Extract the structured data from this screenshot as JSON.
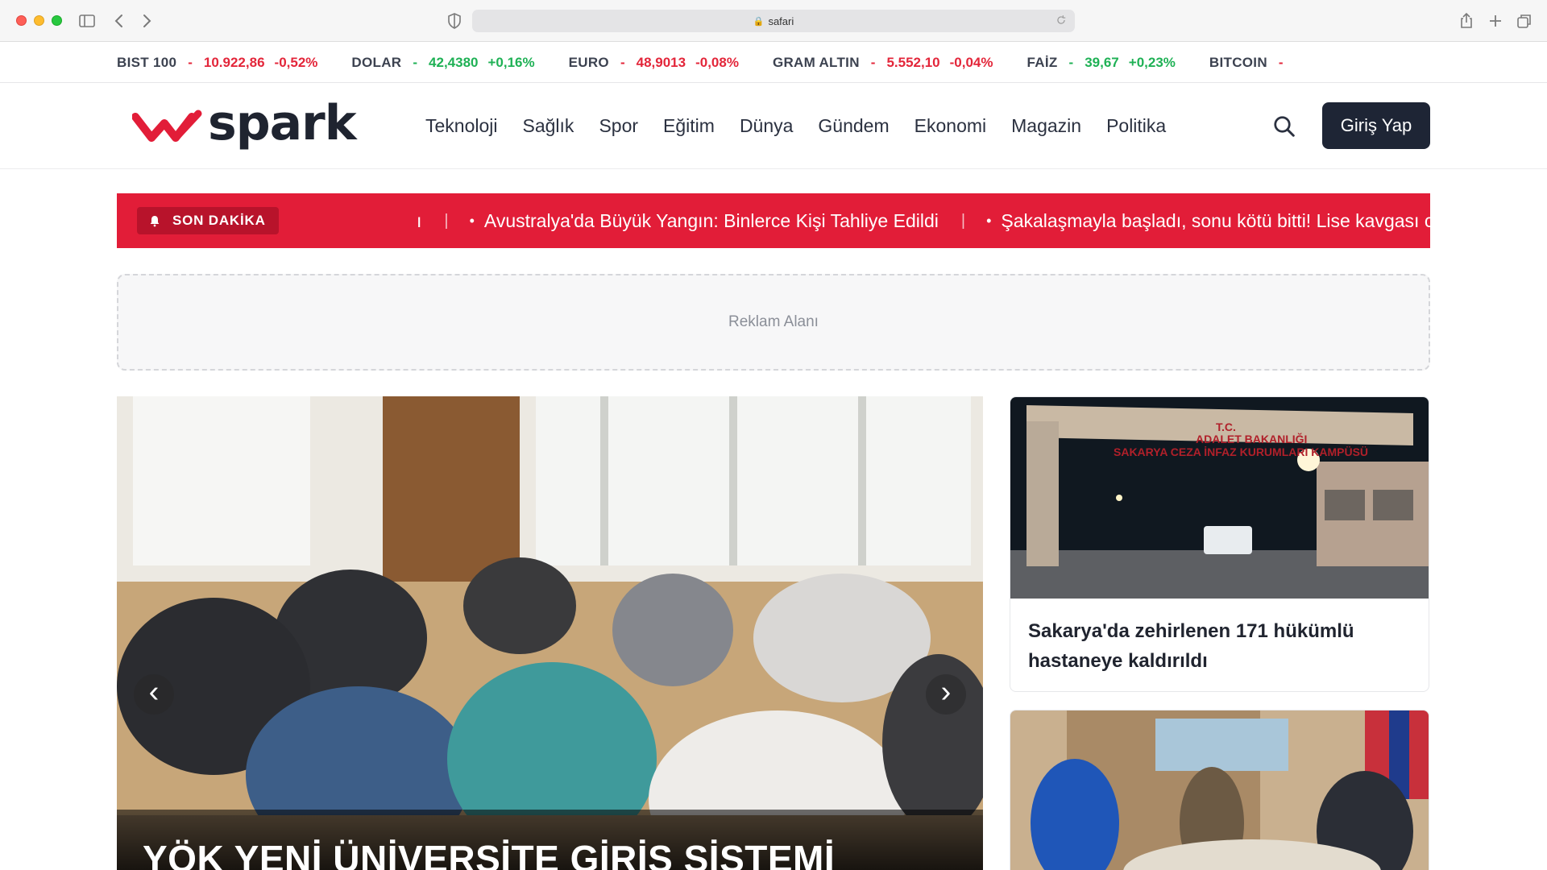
{
  "browser": {
    "address": "safari",
    "lock_glyph": "🔒"
  },
  "ticker": [
    {
      "name": "BIST 100",
      "value": "10.922,86",
      "change": "-0,52%",
      "direction": "down"
    },
    {
      "name": "DOLAR",
      "value": "42,4380",
      "change": "+0,16%",
      "direction": "up"
    },
    {
      "name": "EURO",
      "value": "48,9013",
      "change": "-0,08%",
      "direction": "down"
    },
    {
      "name": "GRAM ALTIN",
      "value": "5.552,10",
      "change": "-0,04%",
      "direction": "down"
    },
    {
      "name": "FAİZ",
      "value": "39,67",
      "change": "+0,23%",
      "direction": "up"
    },
    {
      "name": "BITCOIN",
      "value": "",
      "change": "",
      "direction": "down"
    }
  ],
  "header": {
    "logo_text": "spark",
    "nav": [
      "Teknoloji",
      "Sağlık",
      "Spor",
      "Eğitim",
      "Dünya",
      "Gündem",
      "Ekonomi",
      "Magazin",
      "Politika"
    ],
    "login_label": "Giriş Yap"
  },
  "breaking": {
    "label": "SON DAKİKA",
    "items": [
      "Avustralya'da Büyük Yangın: Binlerce Kişi Tahliye Edildi",
      "Şakalaşmayla başladı, sonu kötü bitti! Lise kavgası can aldı"
    ],
    "separator": "|",
    "partial_glyph": "ı"
  },
  "ad": {
    "label": "Reklam Alanı"
  },
  "hero": {
    "title": "YÖK YENİ ÜNİVERSİTE GİRİŞ SİSTEMİ",
    "prev_glyph": "‹",
    "next_glyph": "›"
  },
  "side_cards": [
    {
      "title": "Sakarya'da zehirlenen 171 hükümlü hastaneye kaldırıldı",
      "sign_lines": [
        "T.C.",
        "ADALET BAKANLIĞI",
        "SAKARYA CEZA İNFAZ KURUMLARI KAMPÜSÜ"
      ]
    },
    {
      "title": ""
    }
  ],
  "colors": {
    "up": "#1fb155",
    "down": "#e3263a",
    "brand_red": "#e21d38",
    "dark_button": "#1e2535"
  }
}
